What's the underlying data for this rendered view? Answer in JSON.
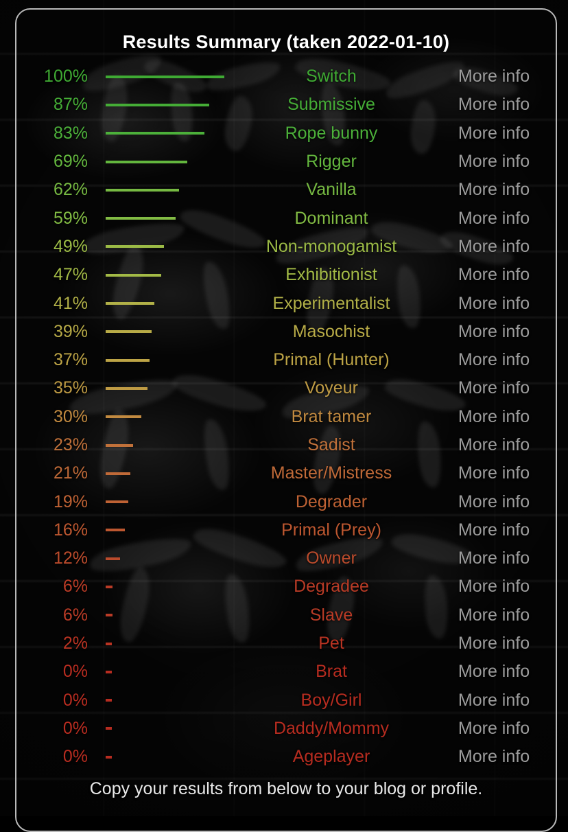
{
  "background": {
    "style": "dark-brick-graffiti-wall",
    "base_color": "#050505"
  },
  "card": {
    "border_color": "#b9b9b9",
    "title": "Results Summary (taken 2022-01-10)",
    "footer": "Copy your results from below to your blog or profile.",
    "more_info_label": "More info",
    "more_info_color": "#9d9d9d"
  },
  "chart_data": {
    "type": "bar",
    "title": "Results Summary (taken 2022-01-10)",
    "orientation": "horizontal",
    "xlabel": "",
    "ylabel": "",
    "xlim": [
      0,
      100
    ],
    "grid": false,
    "legend": null,
    "value_suffix": "%",
    "categories": [
      "Switch",
      "Submissive",
      "Rope bunny",
      "Rigger",
      "Vanilla",
      "Dominant",
      "Non-monogamist",
      "Exhibitionist",
      "Experimentalist",
      "Masochist",
      "Primal (Hunter)",
      "Voyeur",
      "Brat tamer",
      "Sadist",
      "Master/Mistress",
      "Degrader",
      "Primal (Prey)",
      "Owner",
      "Degradee",
      "Slave",
      "Pet",
      "Brat",
      "Boy/Girl",
      "Daddy/Mommy",
      "Ageplayer"
    ],
    "values": [
      100,
      87,
      83,
      69,
      62,
      59,
      49,
      47,
      41,
      39,
      37,
      35,
      30,
      23,
      21,
      19,
      16,
      12,
      6,
      6,
      2,
      0,
      0,
      0,
      0
    ],
    "colors": [
      "#3faa33",
      "#45ad36",
      "#4cb03a",
      "#63b63e",
      "#76b942",
      "#82bb44",
      "#9cbb46",
      "#a3ba46",
      "#b2b148",
      "#b8ab47",
      "#bda446",
      "#bf9b44",
      "#c28a40",
      "#c1713a",
      "#c06a38",
      "#bf6234",
      "#bd5730",
      "#bb4b2c",
      "#b93b26",
      "#b93b26",
      "#b93322",
      "#b72c20",
      "#b72c20",
      "#b72c20",
      "#b72c20"
    ]
  },
  "rows": [
    {
      "pct": "100%",
      "label": "Switch",
      "value": 100,
      "color": "#3faa33",
      "more": "More info"
    },
    {
      "pct": "87%",
      "label": "Submissive",
      "value": 87,
      "color": "#45ad36",
      "more": "More info"
    },
    {
      "pct": "83%",
      "label": "Rope bunny",
      "value": 83,
      "color": "#4cb03a",
      "more": "More info"
    },
    {
      "pct": "69%",
      "label": "Rigger",
      "value": 69,
      "color": "#63b63e",
      "more": "More info"
    },
    {
      "pct": "62%",
      "label": "Vanilla",
      "value": 62,
      "color": "#76b942",
      "more": "More info"
    },
    {
      "pct": "59%",
      "label": "Dominant",
      "value": 59,
      "color": "#82bb44",
      "more": "More info"
    },
    {
      "pct": "49%",
      "label": "Non-monogamist",
      "value": 49,
      "color": "#9cbb46",
      "more": "More info"
    },
    {
      "pct": "47%",
      "label": "Exhibitionist",
      "value": 47,
      "color": "#a3ba46",
      "more": "More info"
    },
    {
      "pct": "41%",
      "label": "Experimentalist",
      "value": 41,
      "color": "#b2b148",
      "more": "More info"
    },
    {
      "pct": "39%",
      "label": "Masochist",
      "value": 39,
      "color": "#b8ab47",
      "more": "More info"
    },
    {
      "pct": "37%",
      "label": "Primal (Hunter)",
      "value": 37,
      "color": "#bda446",
      "more": "More info"
    },
    {
      "pct": "35%",
      "label": "Voyeur",
      "value": 35,
      "color": "#bf9b44",
      "more": "More info"
    },
    {
      "pct": "30%",
      "label": "Brat tamer",
      "value": 30,
      "color": "#c28a40",
      "more": "More info"
    },
    {
      "pct": "23%",
      "label": "Sadist",
      "value": 23,
      "color": "#c1713a",
      "more": "More info"
    },
    {
      "pct": "21%",
      "label": "Master/Mistress",
      "value": 21,
      "color": "#c06a38",
      "more": "More info"
    },
    {
      "pct": "19%",
      "label": "Degrader",
      "value": 19,
      "color": "#bf6234",
      "more": "More info"
    },
    {
      "pct": "16%",
      "label": "Primal (Prey)",
      "value": 16,
      "color": "#bd5730",
      "more": "More info"
    },
    {
      "pct": "12%",
      "label": "Owner",
      "value": 12,
      "color": "#bb4b2c",
      "more": "More info"
    },
    {
      "pct": "6%",
      "label": "Degradee",
      "value": 6,
      "color": "#b93b26",
      "more": "More info"
    },
    {
      "pct": "6%",
      "label": "Slave",
      "value": 6,
      "color": "#b93b26",
      "more": "More info"
    },
    {
      "pct": "2%",
      "label": "Pet",
      "value": 2,
      "color": "#b93322",
      "more": "More info"
    },
    {
      "pct": "0%",
      "label": "Brat",
      "value": 0,
      "color": "#b72c20",
      "more": "More info"
    },
    {
      "pct": "0%",
      "label": "Boy/Girl",
      "value": 0,
      "color": "#b72c20",
      "more": "More info"
    },
    {
      "pct": "0%",
      "label": "Daddy/Mommy",
      "value": 0,
      "color": "#b72c20",
      "more": "More info"
    },
    {
      "pct": "0%",
      "label": "Ageplayer",
      "value": 0,
      "color": "#b72c20",
      "more": "More info"
    }
  ]
}
